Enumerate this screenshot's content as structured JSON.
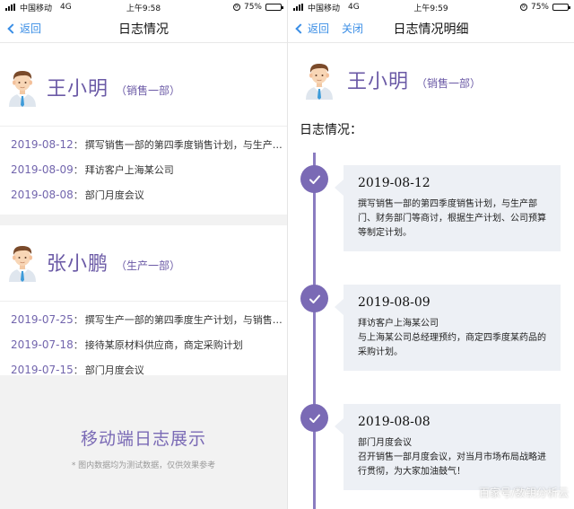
{
  "left": {
    "status": {
      "carrier": "中国移动",
      "network": "4G",
      "time": "上午9:58",
      "battery": "75%",
      "battery_level": 0.75
    },
    "nav": {
      "back_label": "返回",
      "title": "日志情况"
    },
    "users": [
      {
        "name": "王小明",
        "dept": "（销售一部）",
        "logs": [
          {
            "date": "2019-08-12",
            "colon": "：",
            "text": "撰写销售一部的第四季度销售计划，与生产…"
          },
          {
            "date": "2019-08-09",
            "colon": "：",
            "text": "拜访客户上海某公司"
          },
          {
            "date": "2019-08-08",
            "colon": "：",
            "text": "部门月度会议"
          }
        ]
      },
      {
        "name": "张小鹏",
        "dept": "（生产一部）",
        "logs": [
          {
            "date": "2019-07-25",
            "colon": "：",
            "text": "撰写生产一部的第四季度生产计划，与销售…"
          },
          {
            "date": "2019-07-18",
            "colon": "：",
            "text": "接待某原材料供应商，商定采购计划"
          },
          {
            "date": "2019-07-15",
            "colon": "：",
            "text": "部门月度会议"
          }
        ]
      }
    ],
    "promo": {
      "title": "移动端日志展示",
      "note": "* 图内数据均为测试数据，仅供效果参考"
    }
  },
  "right": {
    "status": {
      "carrier": "中国移动",
      "network": "4G",
      "time": "上午9:59",
      "battery": "75%",
      "battery_level": 0.75
    },
    "nav": {
      "back_label": "返回",
      "close_label": "关闭",
      "title": "日志情况明细"
    },
    "user": {
      "name": "王小明",
      "dept": "（销售一部）"
    },
    "section_label": "日志情况：",
    "entries": [
      {
        "date": "2019-08-12",
        "lines": [
          "撰写销售一部的第四季度销售计划，与生产部门、财务部门等商讨，根据生产计划、公司预算等制定计划。"
        ]
      },
      {
        "date": "2019-08-09",
        "lines": [
          "拜访客户上海某公司",
          "与上海某公司总经理预约，商定四季度某药品的采购计划。"
        ]
      },
      {
        "date": "2019-08-08",
        "lines": [
          "部门月度会议",
          "召开销售一部月度会议，对当月市场布局战略进行贯彻，为大家加油鼓气！"
        ]
      }
    ]
  },
  "watermark": "百家号/数钥分析云",
  "colors": {
    "accent": "#7a6ab5",
    "link": "#3a8ee6",
    "card_bg": "#edf0f5",
    "promo_bg": "#f2f2f2"
  }
}
